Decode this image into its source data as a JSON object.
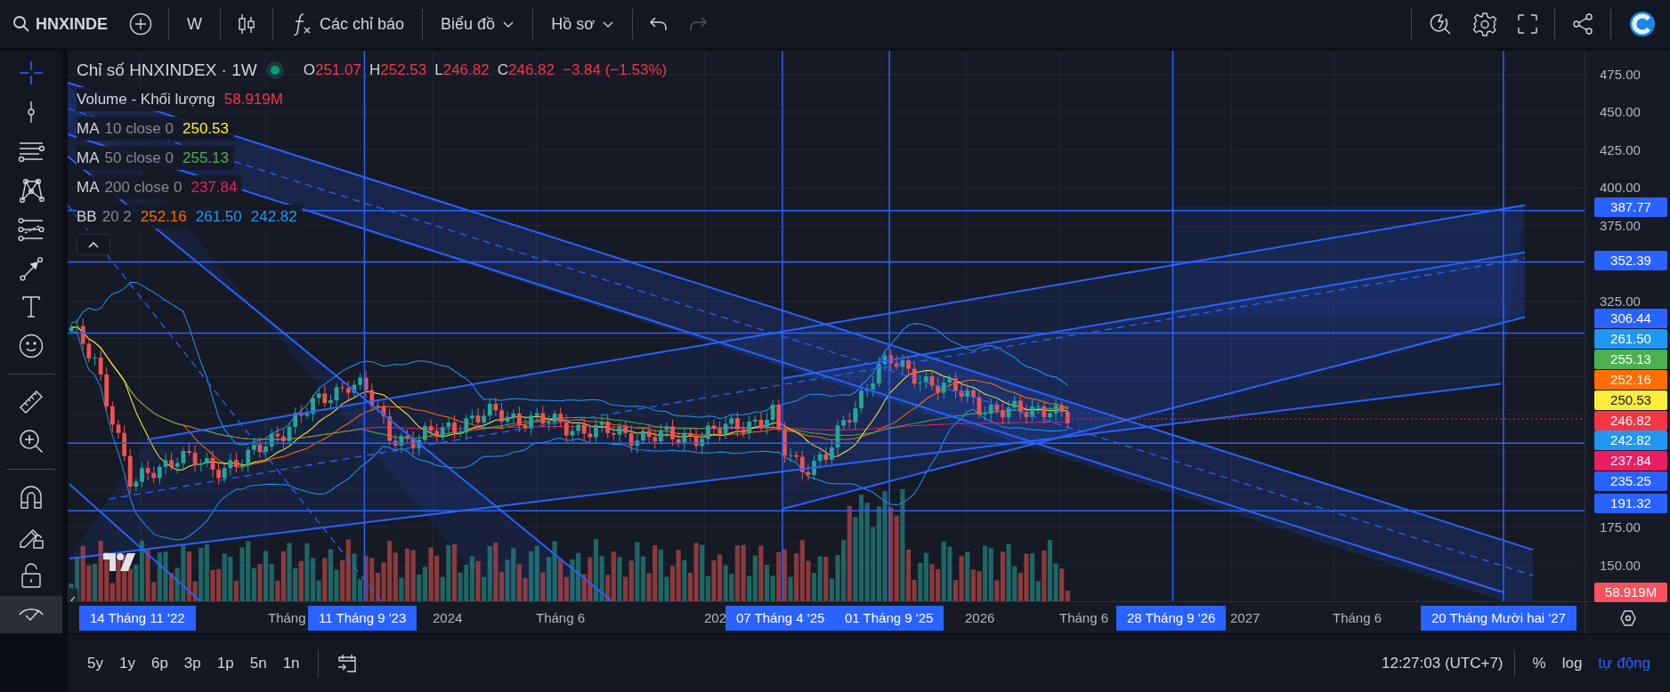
{
  "toolbar": {
    "symbol": "HNXINDE",
    "interval": "W",
    "indicators_label": "Các chỉ báo",
    "chart_menu": "Biểu đồ",
    "profile_menu": "Hồ sơ",
    "redo_disabled": true
  },
  "tool_groups": [
    {
      "tools": [
        {
          "kind": "crosshair",
          "selected": true
        },
        {
          "kind": "vline",
          "selected": false
        },
        {
          "kind": "hlines",
          "selected": false
        },
        {
          "kind": "pattern",
          "selected": false
        },
        {
          "kind": "fib",
          "selected": false
        },
        {
          "kind": "arrow",
          "selected": false
        },
        {
          "kind": "text",
          "selected": false
        },
        {
          "kind": "emoji",
          "selected": false
        }
      ]
    },
    {
      "tools": [
        {
          "kind": "ruler",
          "selected": false
        },
        {
          "kind": "zoom",
          "selected": false
        }
      ]
    },
    {
      "tools": [
        {
          "kind": "magnet",
          "selected": false
        },
        {
          "kind": "pencil-lock",
          "selected": false
        },
        {
          "kind": "lock",
          "selected": false
        },
        {
          "kind": "eye",
          "selected": false
        }
      ]
    }
  ],
  "legend": {
    "title": "Chỉ số HNXINDEX · 1W",
    "ohlc": [
      {
        "key": "O",
        "value": "251.07"
      },
      {
        "key": "H",
        "value": "252.53"
      },
      {
        "key": "L",
        "value": "246.82"
      },
      {
        "key": "C",
        "value": "246.82"
      }
    ],
    "change": "−3.84 (−1.53%)",
    "studies": [
      {
        "name": "Volume - Khối lượng",
        "values": [
          {
            "text": "58.919M",
            "color": "#f23645"
          }
        ]
      },
      {
        "name": "MA",
        "params": "10 close 0",
        "values": [
          {
            "text": "250.53",
            "color": "#ffeb3b"
          }
        ]
      },
      {
        "name": "MA",
        "params": "50 close 0",
        "values": [
          {
            "text": "255.13",
            "color": "#4caf50"
          }
        ]
      },
      {
        "name": "MA",
        "params": "200 close 0",
        "values": [
          {
            "text": "237.84",
            "color": "#e91e63"
          }
        ]
      },
      {
        "name": "BB",
        "params": "20 2",
        "values": [
          {
            "text": "252.16",
            "color": "#ff6d00"
          },
          {
            "text": "261.50",
            "color": "#2196f3"
          },
          {
            "text": "242.82",
            "color": "#2196f3"
          }
        ]
      }
    ]
  },
  "price_axis": {
    "labels": [
      "475.00",
      "450.00",
      "425.00",
      "400.00",
      "375.00",
      "325.00",
      "175.00",
      "150.00"
    ],
    "tags": [
      {
        "text": "387.77",
        "color": "#2962ff"
      },
      {
        "text": "352.39",
        "color": "#2962ff"
      },
      {
        "text": "306.44",
        "color": "#2962ff"
      },
      {
        "text": "261.50",
        "color": "#2196f3"
      },
      {
        "text": "255.13",
        "color": "#4caf50"
      },
      {
        "text": "252.16",
        "color": "#ff6d00"
      },
      {
        "text": "250.53",
        "color": "#ffeb3b"
      },
      {
        "text": "246.82",
        "color": "#f23645"
      },
      {
        "text": "242.82",
        "color": "#2196f3"
      },
      {
        "text": "237.84",
        "color": "#e91e63"
      },
      {
        "text": "235.25",
        "color": "#2962ff"
      },
      {
        "text": "191.32",
        "color": "#2962ff"
      },
      {
        "text": "58.919M",
        "color": "#f7525f"
      }
    ]
  },
  "time_axis": {
    "labels": [
      {
        "text": "14 Tháng 11 '22",
        "highlighted": true
      },
      {
        "text": "Tháng",
        "highlighted": false
      },
      {
        "text": "11 Tháng 9 '23",
        "highlighted": true
      },
      {
        "text": "2024",
        "highlighted": false
      },
      {
        "text": "Tháng 6",
        "highlighted": false
      },
      {
        "text": "202",
        "highlighted": false
      },
      {
        "text": "07 Tháng 4 '25",
        "highlighted": true
      },
      {
        "text": "01 Tháng 9 '25",
        "highlighted": true
      },
      {
        "text": "2026",
        "highlighted": false
      },
      {
        "text": "Tháng 6",
        "highlighted": false
      },
      {
        "text": "28 Tháng 9 '26",
        "highlighted": true
      },
      {
        "text": "2027",
        "highlighted": false
      },
      {
        "text": "Tháng 6",
        "highlighted": false
      },
      {
        "text": "20 Tháng Mười hai '27",
        "highlighted": true
      }
    ]
  },
  "bottom_bar": {
    "ranges": [
      "5y",
      "1y",
      "6p",
      "3p",
      "1p",
      "5n",
      "1n"
    ],
    "clock": "12:27:03 (UTC+7)",
    "scale_modes": [
      {
        "label": "%",
        "selected": false
      },
      {
        "label": "log",
        "selected": false
      },
      {
        "label": "tự động",
        "selected": true
      }
    ]
  }
}
